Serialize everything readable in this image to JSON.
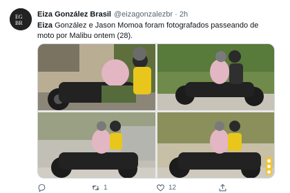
{
  "tweet": {
    "avatar_text": "EGBR",
    "display_name": "Eiza González Brasil",
    "handle": "@eizagonzalezbr",
    "separator": "·",
    "time": "2h",
    "text_bold": "Eiza",
    "text_rest": " González e Jason Momoa foram fotografados passeando de moto por Malibu ontem (28).",
    "media": [
      {
        "icon": "photo-motorcycle-1"
      },
      {
        "icon": "photo-motorcycle-2"
      },
      {
        "icon": "photo-motorcycle-3"
      },
      {
        "icon": "photo-motorcycle-4"
      }
    ],
    "actions": {
      "reply_count": "",
      "retweet_count": "1",
      "like_count": "12",
      "share_count": ""
    }
  },
  "colors": {
    "text": "#0f1419",
    "secondary": "#536471",
    "border": "#cfd9de",
    "badge": "#f4c430"
  }
}
